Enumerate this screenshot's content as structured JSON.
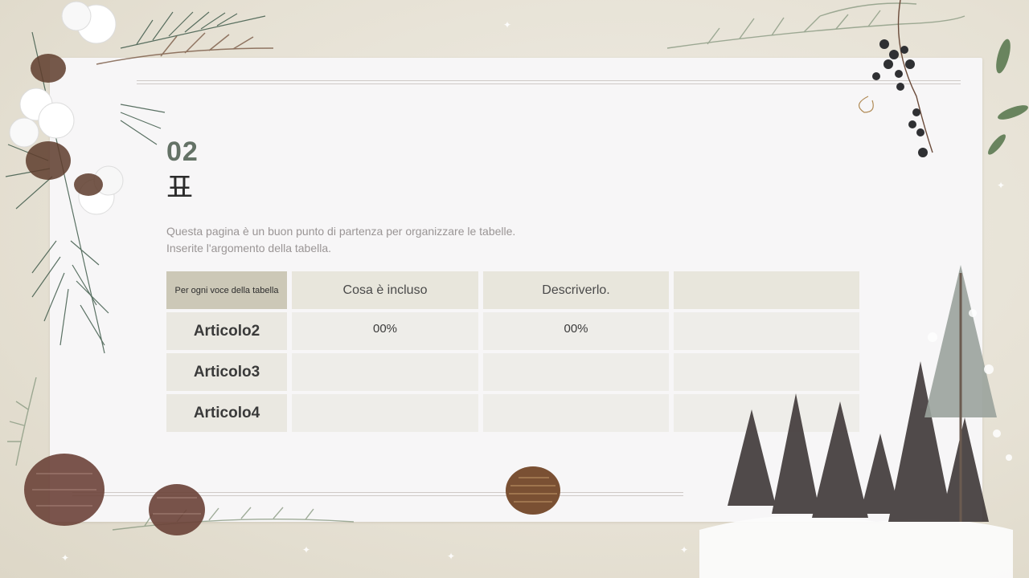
{
  "slide": {
    "number": "02",
    "title": "표",
    "description_lines": [
      "Questa pagina è un buon punto di partenza per organizzare le tabelle.",
      "Inserite l'argomento della tabella."
    ]
  },
  "table": {
    "header": [
      "Per ogni voce della tabella",
      "Cosa è incluso",
      "Descriverlo.",
      ""
    ],
    "rows": [
      {
        "label": "Articolo2",
        "cells": [
          "00%",
          "00%",
          ""
        ]
      },
      {
        "label": "Articolo3",
        "cells": [
          "",
          "",
          ""
        ]
      },
      {
        "label": "Articolo4",
        "cells": [
          "",
          "",
          ""
        ]
      }
    ]
  },
  "colors": {
    "background": "#e8e4d9",
    "card": "#f7f6f7",
    "accent_number": "#647266",
    "header_first": "#ccc8b7"
  },
  "decorations": [
    "pine-branch-icon",
    "cotton-flower-icon",
    "pinecone-icon",
    "berry-branch-icon",
    "leaf-icon",
    "snowy-pine-trees-icon",
    "sparkle-icon"
  ]
}
